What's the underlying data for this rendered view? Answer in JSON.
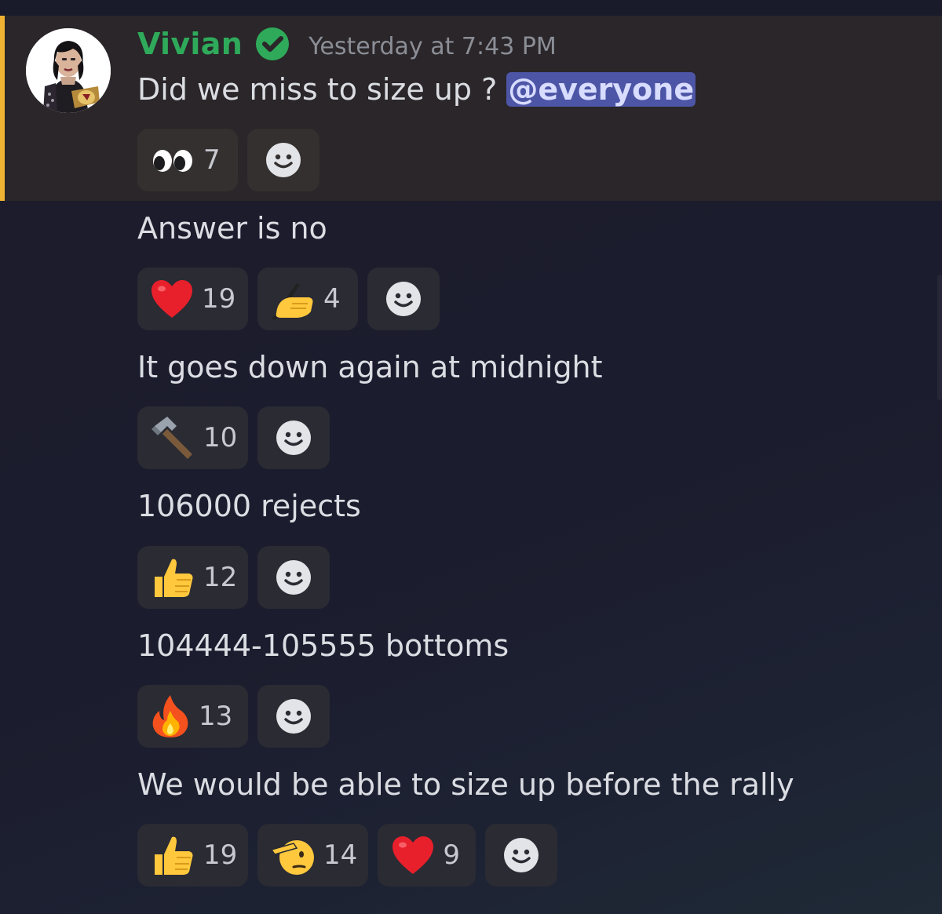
{
  "message_header": {
    "username": "Vivian",
    "timestamp": "Yesterday at 7:43 PM",
    "colors": {
      "username": "#2faa5a",
      "mention_bar": "#f0b232",
      "mention_bg": "#4d55a6"
    }
  },
  "messages": [
    {
      "text": "Did we miss to size up ?",
      "mention": "@everyone",
      "reactions": [
        {
          "emoji": "eyes-icon",
          "count": "7"
        }
      ]
    },
    {
      "text": "Answer is no",
      "reactions": [
        {
          "emoji": "red-heart-icon",
          "count": "19"
        },
        {
          "emoji": "writing-hand-icon",
          "count": "4"
        }
      ]
    },
    {
      "text": "It goes down again at midnight",
      "reactions": [
        {
          "emoji": "hammer-icon",
          "count": "10"
        }
      ]
    },
    {
      "text": "106000 rejects",
      "reactions": [
        {
          "emoji": "thumbs-up-icon",
          "count": "12"
        }
      ]
    },
    {
      "text": "104444-105555 bottoms",
      "reactions": [
        {
          "emoji": "fire-icon",
          "count": "13"
        }
      ]
    },
    {
      "text": "We would be able to size up before the rally",
      "reactions": [
        {
          "emoji": "thumbs-up-icon",
          "count": "19"
        },
        {
          "emoji": "saluting-face-icon",
          "count": "14"
        },
        {
          "emoji": "red-heart-icon",
          "count": "9"
        }
      ]
    }
  ]
}
